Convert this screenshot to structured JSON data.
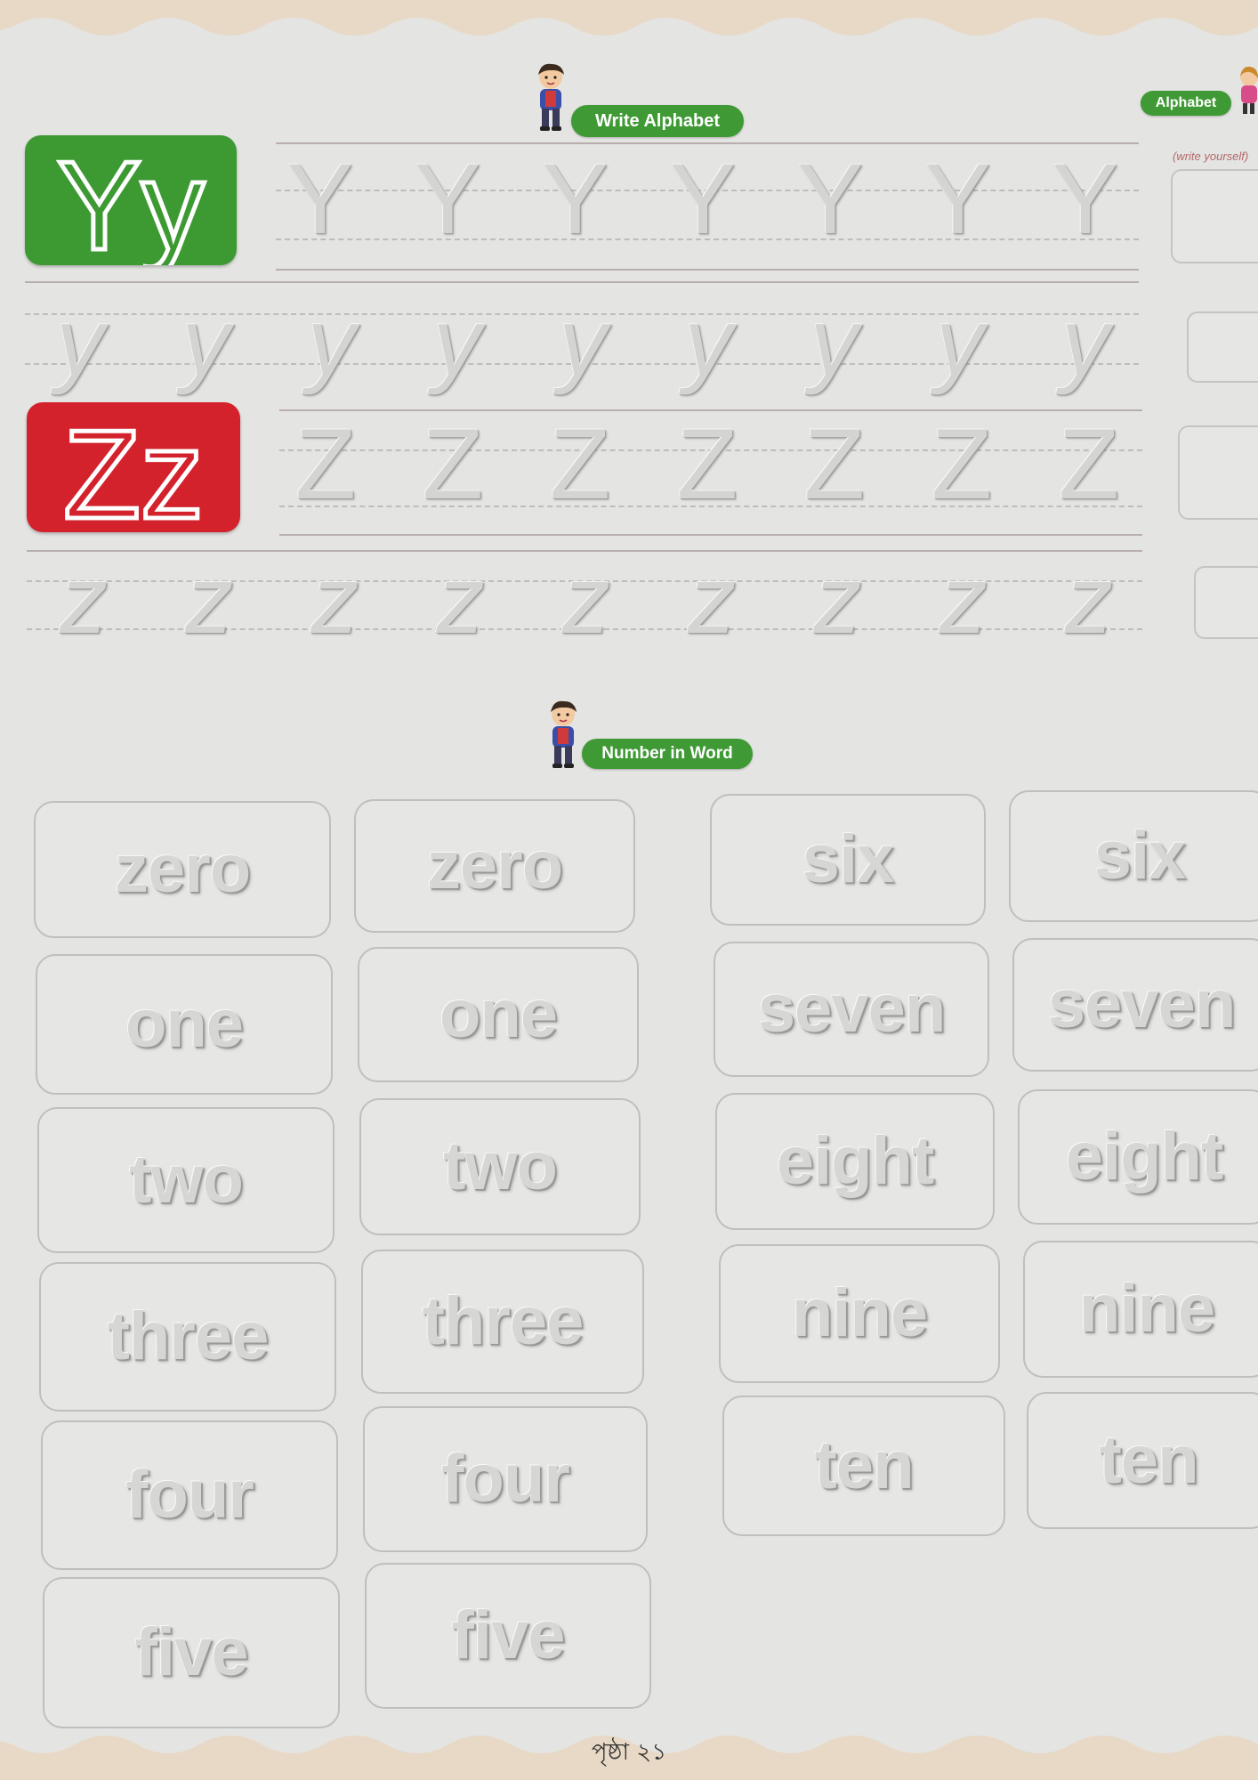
{
  "header": {
    "write_alphabet_label": "Write Alphabet",
    "alphabet_label": "Alphabet",
    "write_yourself_label": "(write yourself)"
  },
  "letters": {
    "y_upper": "Y",
    "y_lower": "y",
    "z_upper": "Z",
    "z_lower": "z",
    "y_tile_text": "Yy",
    "z_tile_text": "Zz"
  },
  "section_number": {
    "label": "Number in Word"
  },
  "number_words": {
    "left": [
      "zero",
      "one",
      "two",
      "three",
      "four",
      "five"
    ],
    "right": [
      "six",
      "seven",
      "eight",
      "nine",
      "ten"
    ]
  },
  "footer": {
    "page_number": "পৃষ্ঠা ২১"
  },
  "colors": {
    "badge_green": "#3f9a35",
    "tile_green": "#3d9a33",
    "tile_red": "#d3222c",
    "page_edge": "#e8d9c6"
  },
  "icons": {
    "kid": "kid-mascot-icon",
    "girl": "girl-mascot-icon"
  }
}
